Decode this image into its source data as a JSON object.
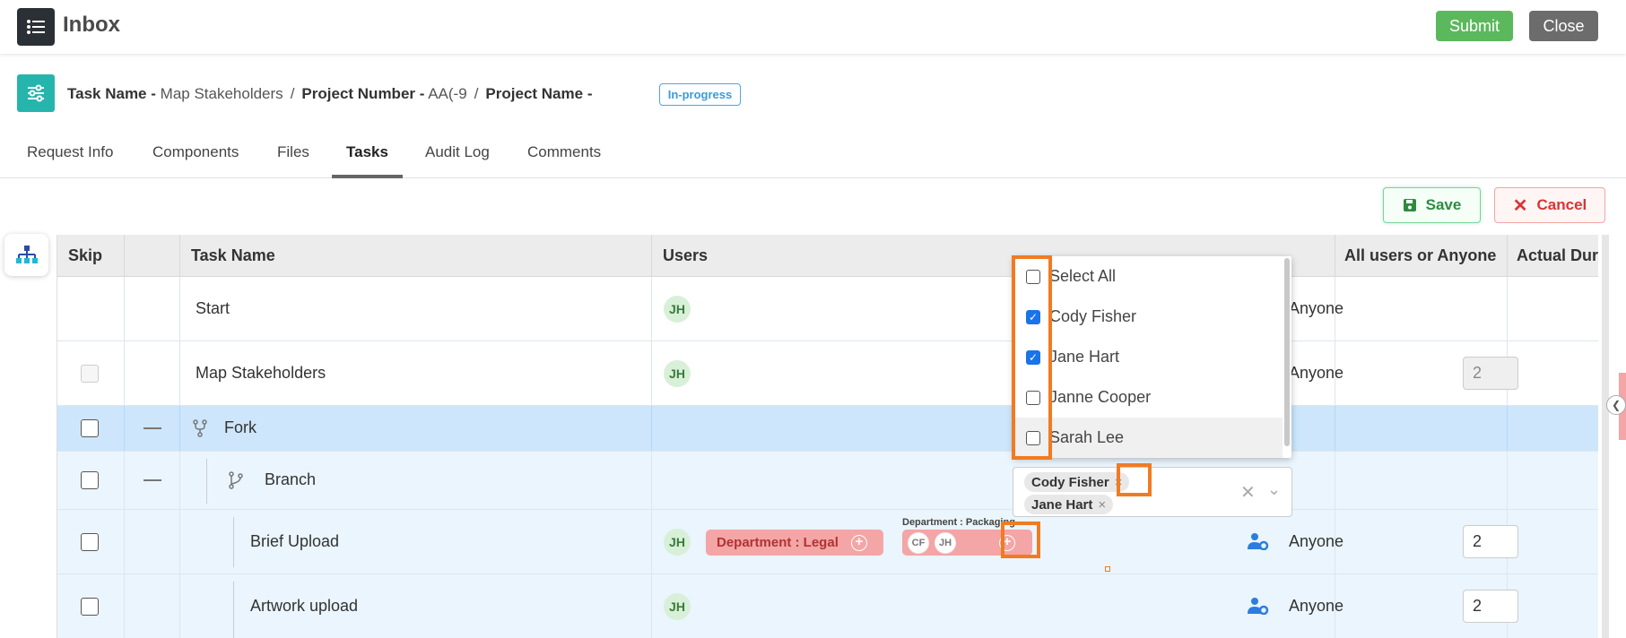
{
  "header": {
    "title": "Inbox",
    "submit_label": "Submit",
    "close_label": "Close"
  },
  "breadcrumb": {
    "task_label": "Task Name",
    "task_value": "Map Stakeholders",
    "project_number_label": "Project Number",
    "project_number_value": "AA(-9",
    "project_name_label": "Project Name",
    "dash": "-",
    "separator": "/",
    "status": "In-progress"
  },
  "tabs": [
    "Request Info",
    "Components",
    "Files",
    "Tasks",
    "Audit Log",
    "Comments"
  ],
  "actions": {
    "save_label": "Save",
    "cancel_label": "Cancel"
  },
  "columns": [
    "Skip",
    "Task Name",
    "Users",
    "All users or Anyone",
    "Actual Duration"
  ],
  "rows": [
    {
      "name": "Start",
      "user": "JH",
      "scope": "Anyone",
      "duration": ""
    },
    {
      "name": "Map Stakeholders",
      "user": "JH",
      "scope": "Anyone",
      "duration": "2"
    },
    {
      "name": "Fork"
    },
    {
      "name": "Branch"
    },
    {
      "name": "Brief Upload",
      "user": "JH",
      "dept1": "Department : Legal",
      "dept2_label": "Department : Packaging",
      "dept2_users": [
        "CF",
        "JH"
      ],
      "scope": "Anyone",
      "duration": "2"
    },
    {
      "name": "Artwork upload",
      "user": "JH",
      "scope": "Anyone",
      "duration": "2"
    }
  ],
  "dropdown": {
    "options": [
      {
        "label": "Select All",
        "checked": false
      },
      {
        "label": "Cody Fisher",
        "checked": true
      },
      {
        "label": "Jane Hart",
        "checked": true
      },
      {
        "label": "Janne Cooper",
        "checked": false
      },
      {
        "label": "Sarah Lee",
        "checked": false
      }
    ],
    "selected": [
      "Cody Fisher",
      "Jane Hart"
    ],
    "remove_glyph": "×",
    "clear_glyph": "✕",
    "chevron_glyph": "⌄"
  },
  "colors": {
    "accent": "#26b5ad",
    "submit": "#5cb85c",
    "highlight": "#f07b22",
    "fork_row": "#cde6fb",
    "branch_row": "#eaf5fd"
  }
}
